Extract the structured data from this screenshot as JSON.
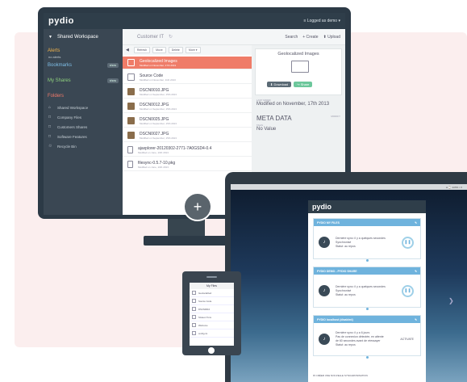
{
  "desktop": {
    "logo": "pydio",
    "user_menu": "≡ Logged as demo ▾",
    "workspace": "Shared Workspace",
    "breadcrumb": "Customer IT",
    "search": "Search",
    "create": "+ Create",
    "upload": "⬆ Upload",
    "toolbar": [
      "Refresh",
      "Move",
      "Delete",
      "More ▾"
    ],
    "sidebar": {
      "alerts": "Alerts",
      "alerts_sub": "no alerts",
      "bookmarks": "Bookmarks",
      "bookmarks_badge": "show",
      "shares": "My Shares",
      "shares_badge": "show",
      "folders": "Folders",
      "folder_items": [
        "Shared Workspace",
        "Company Files",
        "Customers Shares",
        "Software Features",
        "Recycle Bin"
      ]
    },
    "files": [
      {
        "name": "Geolocalized Images",
        "sub": "Modified on November, 17th 2013",
        "selected": true,
        "kind": "folder"
      },
      {
        "name": "Source Code",
        "sub": "Modified on November, 11th 2013",
        "selected": false,
        "kind": "folder"
      },
      {
        "name": "DSCN0010.JPG",
        "sub": "Modified on September, 15th 2013",
        "selected": false,
        "kind": "image"
      },
      {
        "name": "DSCN0012.JPG",
        "sub": "Modified on September, 15th 2013",
        "selected": false,
        "kind": "image"
      },
      {
        "name": "DSCN0025.JPG",
        "sub": "Modified on September, 15th 2013",
        "selected": false,
        "kind": "image"
      },
      {
        "name": "DSCN0027.JPG",
        "sub": "Modified on September, 15th 2013",
        "selected": false,
        "kind": "image"
      },
      {
        "name": "ajaxplorer-20120302-2771-7A0GSD4-0.4",
        "sub": "Modified on June, 10th 2013",
        "selected": false,
        "kind": "file"
      },
      {
        "name": "filesync-0.5.7-10.pkg",
        "sub": "Modified on June, 10th 2013",
        "selected": false,
        "kind": "file"
      }
    ],
    "details": {
      "title": "Geolocalized Images",
      "download": "⬇ Download",
      "share": "↪ Share",
      "last_modif_label": "LAST MODIF",
      "last_modif": "Modified on November, 17th 2013",
      "meta_title": "META DATA",
      "meta_edit": "MODIFY",
      "tags_label": "TAGS",
      "tags_value": "No Value"
    }
  },
  "sync_app": {
    "logo": "pydio",
    "os_bar": "●  ⌚ 14:53  ⌕ ≡",
    "tasks": [
      {
        "title": "PYDIO MY FILES",
        "lines": [
          "Dernière sync: il y a quelques secondes",
          "Synchronisé",
          "Statut: au repos"
        ],
        "action": "pause"
      },
      {
        "title": "PYDIO DEMO - PYDIO SHARE",
        "lines": [
          "Dernière sync: il y a quelques secondes",
          "Synchronisé",
          "Statut: au repos"
        ],
        "action": "pause"
      },
      {
        "title": "PYDIO localhost (disabled)",
        "lines": [
          "Dernière sync: il y a 6 jours",
          "Pas de connexion détectée, en attente",
          "de 60 secondes avant de réessayer",
          "Statut: au repos"
        ],
        "action": "ACTIVATE"
      }
    ],
    "footer": "⚙ CRÉER UNE NOUVELLE SYNCHRONISATION"
  },
  "phone": {
    "title": "My Files",
    "rows": [
      "Geolocalized",
      "Source Code",
      "DSCN0010",
      "Sixteen Tons",
      "Welcome",
      "config.ini"
    ]
  }
}
